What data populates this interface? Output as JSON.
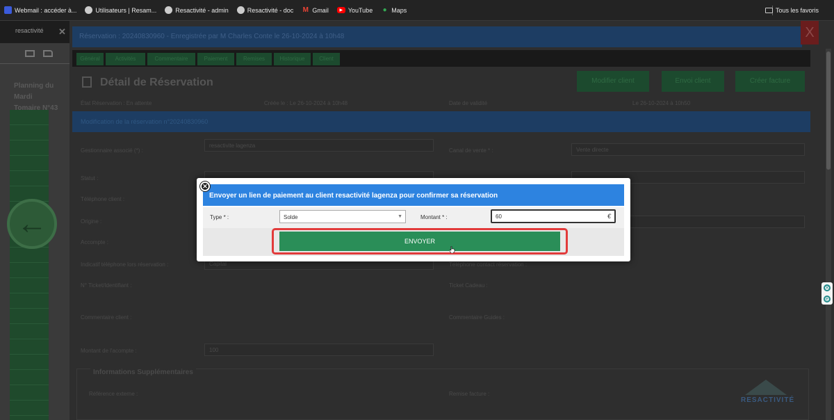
{
  "bookmarks": {
    "items": [
      {
        "label": "Webmail : accéder à...",
        "icon": "webmail-icon",
        "color": "#3b5bdb"
      },
      {
        "label": "Utilisateurs | Resam...",
        "icon": "globe-icon",
        "color": "#cccccc"
      },
      {
        "label": "Resactivité - admin",
        "icon": "globe-icon",
        "color": "#cccccc"
      },
      {
        "label": "Resactivité - doc",
        "icon": "globe-icon",
        "color": "#cccccc"
      },
      {
        "label": "Gmail",
        "icon": "gmail-icon",
        "color": "#ea4335"
      },
      {
        "label": "YouTube",
        "icon": "youtube-icon",
        "color": "#ff0000"
      },
      {
        "label": "Maps",
        "icon": "maps-icon",
        "color": "#34a853"
      }
    ],
    "all_favorites": "Tous les favoris"
  },
  "background": {
    "left_top_label": "resactivité",
    "planning_line1": "Planning du Mardi",
    "planning_line2": "Tomaire N°43",
    "res_header": "Réservation : 20240830960 - Enregistrée par M Charles Conte le 26-10-2024 à 10h48",
    "tabs": [
      "Général",
      "Activités",
      "Commentaire",
      "Paiement",
      "Remises",
      "Historique",
      "Client"
    ],
    "detail_title": "Détail de Réservation",
    "top_buttons": [
      "Modifier client",
      "Envoi client",
      "Créer facture"
    ],
    "info": {
      "etat": "État Réservation : En attente",
      "cree": "Créée le : Le 26-10-2024 à 10h48",
      "validite_label": "Date de validité",
      "validite_value": "Le 26-10-2024 à 10h50"
    },
    "band_title": "Modification de la réservation n°20240830960",
    "form": {
      "gestionnaire_label": "Gestionnaire associé (*) :",
      "gestionnaire_value": "resactivite lagenza",
      "canal_label": "Canal de vente * :",
      "canal_value": "Vente directe",
      "statut_label": "Statut :",
      "telephone_label": "Téléphone client :",
      "origine_label": "Origine :",
      "accompte_label": "Accompte :",
      "indicatif_label": "Indicatif téléphone lors réservation :",
      "indicatif_value": "Capital",
      "telephone_contact_label": "Téléphone contact réservation :",
      "ticket_label": "N° Ticket/Identifiant :",
      "ticket_cadeau_label": "Ticket Cadeau :",
      "commentaire_label": "Commentaire client :",
      "commentaire_guide_label": "Commentaire Guides :",
      "montant_label": "Montant de l'acompte :",
      "montant_value": "100",
      "fieldset_title": "Informations Supplémentaires",
      "reference_label": "Référence externe :",
      "remise_label": "Remise facture :"
    },
    "logo": "RESACTIVITÉ"
  },
  "modal": {
    "title": "Envoyer un lien de paiement au client resactivité lagenza pour confirmer sa réservation",
    "type_label": "Type * :",
    "type_value": "Solde",
    "montant_label": "Montant * :",
    "montant_value": "60",
    "currency": "€",
    "send_label": "ENVOYER",
    "colors": {
      "header": "#2d83e0",
      "send": "#2a8e58",
      "highlight": "#e23b3b"
    }
  }
}
